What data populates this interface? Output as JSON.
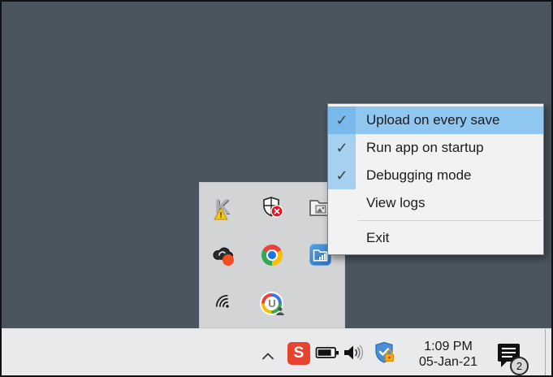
{
  "colors": {
    "desktop_bg": "#4a5560",
    "taskbar_bg": "#e8eaeb",
    "tray_popup_bg": "#d3d4d6",
    "menu_bg": "#f2f2f2",
    "menu_highlight": "#90c7f1",
    "menu_highlight_gutter": "#79b9ec",
    "menu_checked_gutter": "#a6d0f0",
    "s_app_red": "#e8432e",
    "warning_yellow": "#f5c71a",
    "alert_red": "#e81123",
    "record_orange": "#f04e23"
  },
  "context_menu": {
    "check_glyph": "✓",
    "items": [
      {
        "label": "Upload on every save",
        "checked": true,
        "highlighted": true
      },
      {
        "label": "Run app on startup",
        "checked": true,
        "highlighted": false
      },
      {
        "label": "Debugging mode",
        "checked": true,
        "highlighted": false
      },
      {
        "label": "View logs",
        "checked": false,
        "highlighted": false
      },
      {
        "label": "Exit",
        "checked": false,
        "highlighted": false,
        "separator_before": true
      }
    ]
  },
  "tray_popup": {
    "icons": [
      {
        "name": "app-k-warning-icon",
        "glyph": "K",
        "warning_glyph": "!"
      },
      {
        "name": "defender-alert-icon"
      },
      {
        "name": "folder-photo-icon"
      },
      {
        "name": "cloud-record-icon"
      },
      {
        "name": "chrome-icon"
      },
      {
        "name": "uploader-app-icon"
      },
      {
        "name": "wifi-icon"
      },
      {
        "name": "updater-circle-icon",
        "glyph": "U"
      }
    ]
  },
  "taskbar": {
    "s_app_glyph": "S",
    "clock": {
      "time": "1:09 PM",
      "date": "05-Jan-21"
    },
    "notification_count": "2"
  }
}
